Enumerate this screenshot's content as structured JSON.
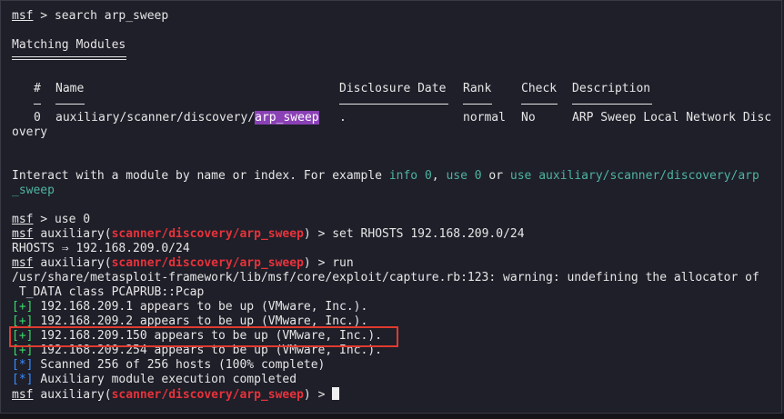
{
  "prompt": {
    "msf": "msf",
    "auxiliary": "auxiliary",
    "module": "scanner/discovery/arp_sweep",
    "open": "(",
    "close": ")",
    "arrow": " > "
  },
  "lines": {
    "search_cmd": "search arp_sweep",
    "matching": "Matching Modules",
    "headers": {
      "num": "#",
      "name": "Name",
      "date": "Disclosure Date",
      "rank": "Rank",
      "check": "Check",
      "desc": "Description"
    },
    "row": {
      "num": "0",
      "name_prefix": "auxiliary/scanner/discovery/",
      "name_hl": "arp_sweep",
      "date": ".",
      "rank": "normal",
      "check": "No",
      "desc": "ARP Sweep Local Network Disc",
      "wrap": "overy"
    },
    "interact_a": "Interact with a module by name or index. For example ",
    "info0": "info 0",
    "comma": ", ",
    "use0": "use 0",
    "or": " or ",
    "use_path": "use auxiliary/scanner/discovery/arp",
    "use_path_wrap": "_sweep",
    "use0_cmd": "use 0",
    "set_cmd": "set RHOSTS 192.168.209.0/24",
    "rhosts_out": "RHOSTS ⇒ 192.168.209.0/24",
    "run_cmd": "run",
    "warn1": "/usr/share/metasploit-framework/lib/msf/core/exploit/capture.rb:123: warning: undefining the allocator of",
    "warn2": " T_DATA class PCAPRUB::Pcap",
    "plus": "[+]",
    "star": "[*]",
    "up1": "192.168.209.1 appears to be up (VMware, Inc.).",
    "up2": "192.168.209.2 appears to be up (VMware, Inc.).",
    "up3": "192.168.209.150 appears to be up (VMware, Inc.).",
    "up4": "192.168.209.254 appears to be up (VMware, Inc.).",
    "scanned": "Scanned 256 of 256 hosts (100% complete)",
    "completed": "Auxiliary module execution completed"
  },
  "colors": {
    "background": "#1e1f29",
    "prompt_module": "#e8323a",
    "hint": "#4fb3a0",
    "success": "#3bd96b",
    "info": "#3a8bff",
    "highlight": "#8a41b5",
    "annotation_box": "#e03a2f"
  }
}
